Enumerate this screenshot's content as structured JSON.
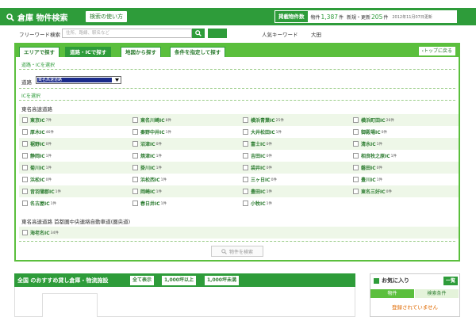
{
  "header": {
    "title": "倉庫 物件検索",
    "how_to_button": "検索の使い方",
    "stats": {
      "badge": "掲載物件数",
      "property_label": "物件",
      "property_count": "1,387",
      "property_unit": "件",
      "updated_label": "新規・更新",
      "updated_count": "205",
      "updated_unit": "件",
      "date": "2012年11月07日更新"
    }
  },
  "search": {
    "label": "フリーワード検索",
    "placeholder": "住所、路線、駅名など",
    "go_button": "",
    "popular_label": "人気キーワード",
    "popular_keyword": "大田"
  },
  "tabs": [
    {
      "label": "エリアで探す"
    },
    {
      "label": "道路・ICで探す"
    },
    {
      "label": "地図から探す"
    },
    {
      "label": "条件を指定して探す"
    }
  ],
  "back_to_top": "トップに戻る",
  "road_section_title": "道路・ICを選択",
  "road_label": "道路",
  "road_selected": "東名高速道路",
  "ic_section_title": "ICを選択",
  "group1": {
    "label": "東名高速道路",
    "rows": [
      [
        {
          "name": "東京IC",
          "count": "7件"
        },
        {
          "name": "東名川崎IC",
          "count": "8件"
        },
        {
          "name": "横浜青葉IC",
          "count": "25件"
        },
        {
          "name": "横浜町田IC",
          "count": "26件"
        }
      ],
      [
        {
          "name": "厚木IC",
          "count": "46件"
        },
        {
          "name": "秦野中井IC",
          "count": "1件"
        },
        {
          "name": "大井松田IC",
          "count": "1件"
        },
        {
          "name": "御殿場IC",
          "count": "0件"
        }
      ],
      [
        {
          "name": "裾野IC",
          "count": "0件"
        },
        {
          "name": "沼津IC",
          "count": "0件"
        },
        {
          "name": "富士IC",
          "count": "0件"
        },
        {
          "name": "清水IC",
          "count": "1件"
        }
      ],
      [
        {
          "name": "静岡IC",
          "count": "1件"
        },
        {
          "name": "焼津IC",
          "count": "1件"
        },
        {
          "name": "吉田IC",
          "count": "0件"
        },
        {
          "name": "相良牧之原IC",
          "count": "1件"
        }
      ],
      [
        {
          "name": "菊川IC",
          "count": "1件"
        },
        {
          "name": "掛川IC",
          "count": "1件"
        },
        {
          "name": "袋井IC",
          "count": "0件"
        },
        {
          "name": "磐田IC",
          "count": "0件"
        }
      ],
      [
        {
          "name": "浜松IC",
          "count": "0件"
        },
        {
          "name": "浜松西IC",
          "count": "1件"
        },
        {
          "name": "三ヶ日IC",
          "count": "0件"
        },
        {
          "name": "豊川IC",
          "count": "1件"
        }
      ],
      [
        {
          "name": "音羽蒲郡IC",
          "count": "1件"
        },
        {
          "name": "岡崎IC",
          "count": "1件"
        },
        {
          "name": "豊田IC",
          "count": "1件"
        },
        {
          "name": "東名三好IC",
          "count": "0件"
        }
      ],
      [
        {
          "name": "名古屋IC",
          "count": "1件"
        },
        {
          "name": "春日井IC",
          "count": "1件"
        },
        {
          "name": "小牧IC",
          "count": "1件"
        }
      ]
    ]
  },
  "group2": {
    "label": "東名高速道路 首都圏中央連絡自動車道(圏央道)",
    "rows": [
      [
        {
          "name": "海老名IC",
          "count": "34件"
        }
      ]
    ]
  },
  "search_button": "物件を検索",
  "recommend": {
    "title": "全国 のおすすめ貸し倉庫・物流施設",
    "buttons": [
      "全て表示",
      "1,000坪以上",
      "1,000坪未満"
    ]
  },
  "favorites": {
    "title": "お気に入り",
    "list_button": "一覧",
    "tabs": [
      "物件",
      "検索条件"
    ],
    "empty_message": "登録されていません"
  },
  "colors": {
    "brand_green": "#2e9c3a",
    "light_green": "#5bbf3d",
    "row_stripe": "#eef7e8",
    "notice_orange": "#e06a00"
  }
}
